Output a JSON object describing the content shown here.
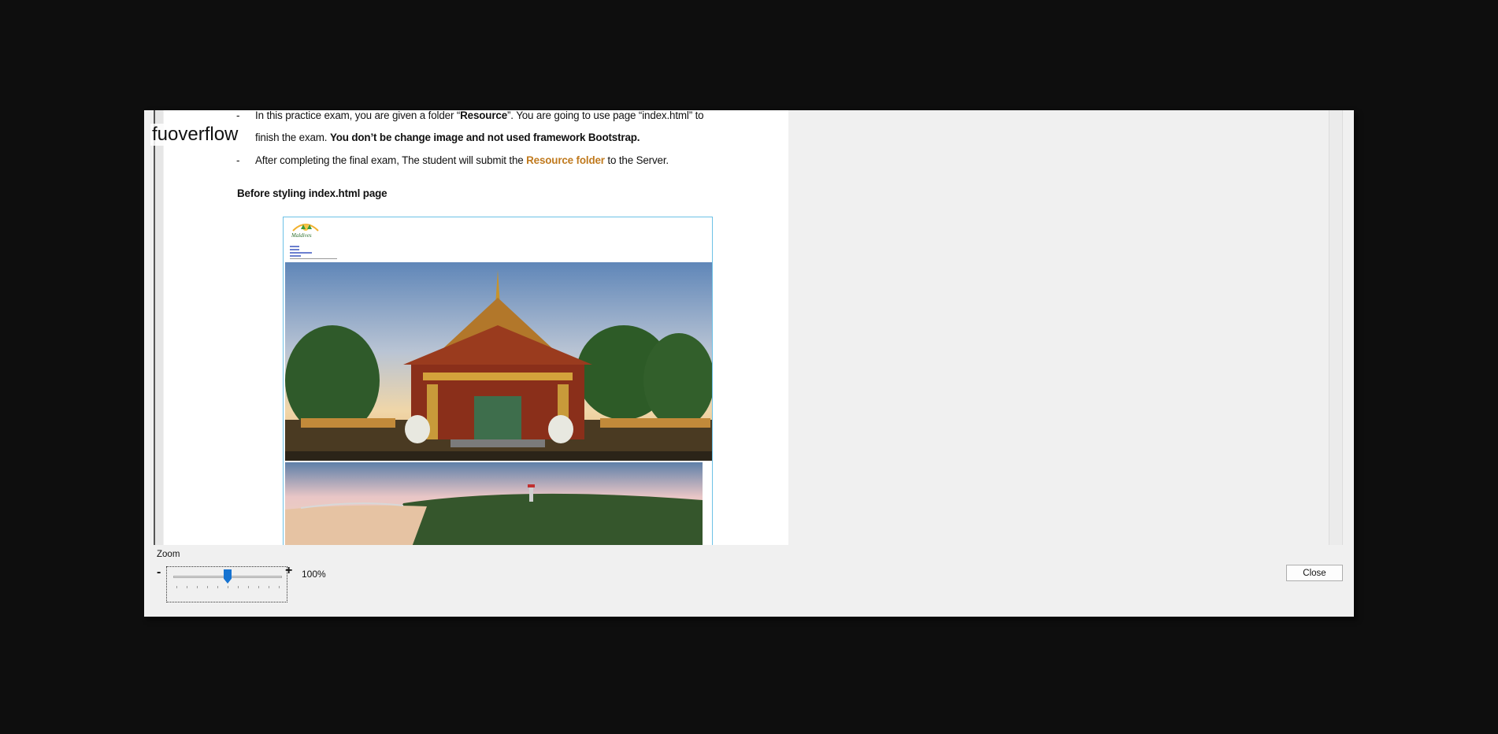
{
  "watermark": "fuoverflow",
  "document": {
    "bullet1_line1_a": "In this practice exam, you are given a folder “",
    "bullet1_line1_bold": "Resource",
    "bullet1_line1_b": "”. You are going to use page “index.html”  to",
    "bullet1_line2_a": "finish the exam. ",
    "bullet1_line2_bold": "You don’t be change image and not used framework Bootstrap.",
    "bullet2_a": "After completing the final exam, The student will submit the ",
    "bullet2_highlight": "Resource folder",
    "bullet2_b": " to the Server.",
    "heading": "Before styling index.html page",
    "dash": "-"
  },
  "zoom": {
    "label": "Zoom",
    "minus": "-",
    "plus": "+",
    "value_text": "100%",
    "slider_fraction": 0.5
  },
  "buttons": {
    "close": "Close"
  },
  "colors": {
    "accent": "#1673d1",
    "highlight": "#c07a1e",
    "screenshot_border": "#6cc1e6"
  }
}
